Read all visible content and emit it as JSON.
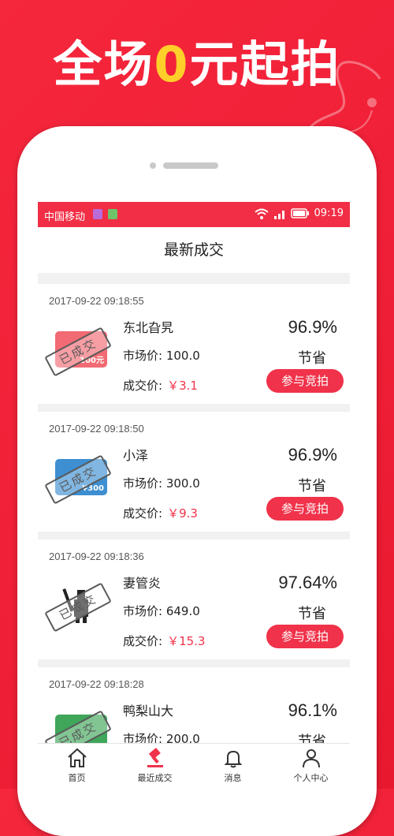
{
  "banner": {
    "part1": "全场",
    "zero": "0",
    "part2": "元起拍"
  },
  "status_bar": {
    "carrier": "中国移动",
    "time": "09:19"
  },
  "page_title": "最新成交",
  "labels": {
    "market_price": "市场价:",
    "deal_price": "成交价:",
    "save": "节省",
    "bid_button": "参与竞拍",
    "sold_stamp": "已成交"
  },
  "records": [
    {
      "time": "2017-09-22 09:18:55",
      "name": "东北旮旯",
      "market_price": "100.0",
      "deal_price": "￥3.1",
      "save_pct": "96.9%",
      "card_face": "100元",
      "card_color": "#f26a73"
    },
    {
      "time": "2017-09-22 09:18:50",
      "name": "小泽",
      "market_price": "300.0",
      "deal_price": "￥9.3",
      "save_pct": "96.9%",
      "card_face": "¥300",
      "card_color": "#3d8fd1"
    },
    {
      "time": "2017-09-22 09:18:36",
      "name": "妻管炎",
      "market_price": "649.0",
      "deal_price": "￥15.3",
      "save_pct": "97.64%",
      "card_face": "",
      "card_color": "#ffffff"
    },
    {
      "time": "2017-09-22 09:18:28",
      "name": "鸭梨山大",
      "market_price": "200.0",
      "deal_price": "",
      "save_pct": "96.1%",
      "card_face": "",
      "card_color": "#3fa65a"
    }
  ],
  "tabs": [
    {
      "label": "首页",
      "icon": "home-icon"
    },
    {
      "label": "最近成交",
      "icon": "gavel-icon"
    },
    {
      "label": "消息",
      "icon": "bell-icon"
    },
    {
      "label": "个人中心",
      "icon": "user-icon"
    }
  ],
  "colors": {
    "accent": "#f0324a",
    "background": "#f12e45",
    "highlight": "#ffd02a"
  }
}
